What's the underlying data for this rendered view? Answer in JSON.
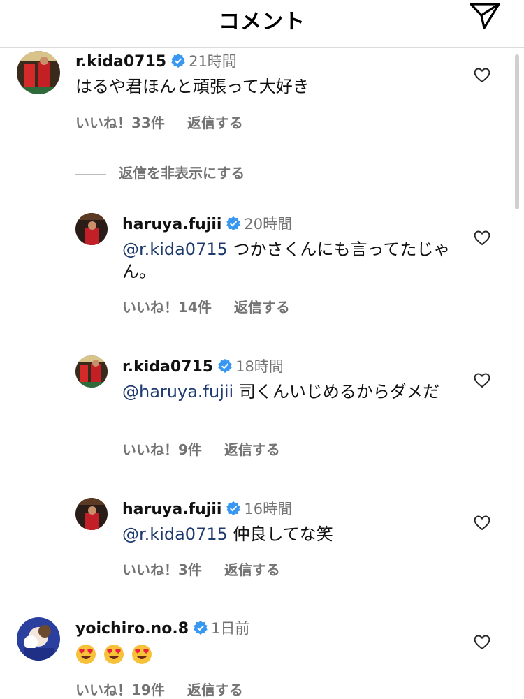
{
  "header": {
    "title": "コメント"
  },
  "hide_replies_label": "返信を非表示にする",
  "like_prefix": "いいね！",
  "reply_label": "返信する",
  "comments": [
    {
      "user": "r.kida0715",
      "time": "21時間",
      "text": "はるや君ほんと頑張って大好き",
      "likes": "33件"
    },
    {
      "user": "haruya.fujii",
      "time": "20時間",
      "mention": "@r.kida0715",
      "text": " つかさくんにも言ってたじゃん。",
      "likes": "14件"
    },
    {
      "user": "r.kida0715",
      "time": "18時間",
      "mention": "@haruya.fujii",
      "text": " 司くんいじめるからダメだ",
      "likes": "9件"
    },
    {
      "user": "haruya.fujii",
      "time": "16時間",
      "mention": "@r.kida0715",
      "text": " 仲良してな笑",
      "likes": "3件"
    },
    {
      "user": "yoichiro.no.8",
      "time": "1日前",
      "emojis": [
        "heart-eyes",
        "heart-eyes",
        "heart-eyes"
      ],
      "likes": "19件"
    }
  ],
  "colors": {
    "verified": "#3897f0",
    "mention": "#1e3a6e",
    "secondary": "#737373"
  }
}
